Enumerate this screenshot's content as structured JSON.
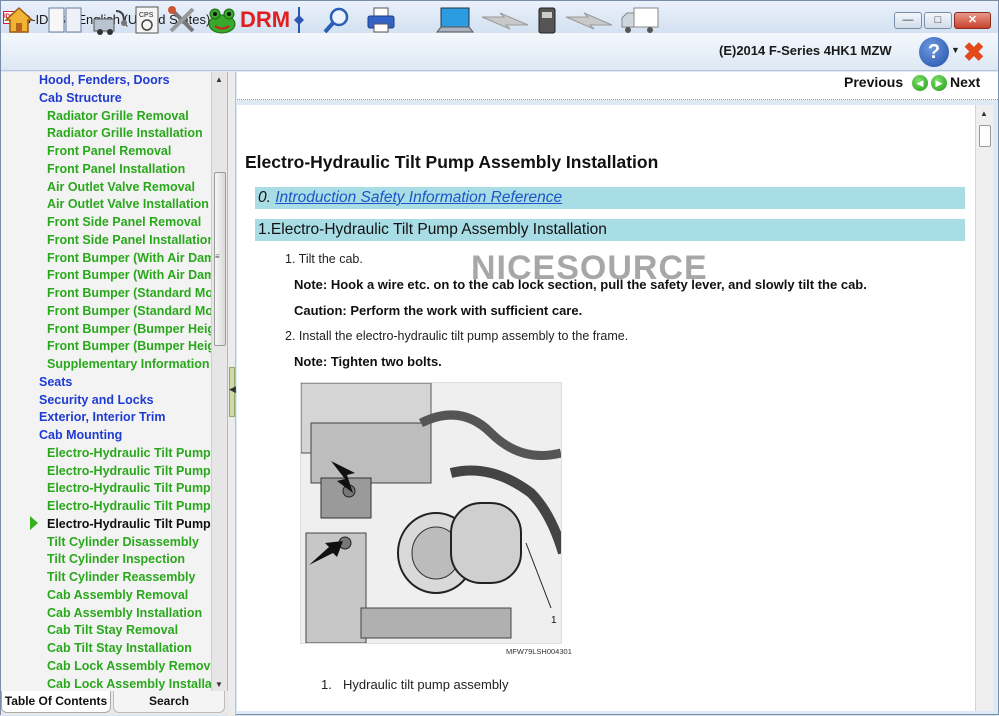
{
  "window": {
    "title": "G-IDSS - English (United States)",
    "app_icon_text": "IDSS",
    "min_glyph": "—",
    "max_glyph": "□",
    "close_glyph": "✕"
  },
  "toolbar": {
    "drm_label": "DRM",
    "vehicle": "(E)2014 F-Series 4HK1 MZW",
    "help_glyph": "?",
    "help_dropdown_glyph": "▼",
    "exit_glyph": "✖",
    "icons": [
      "home-icon",
      "book-icon",
      "diagnosis-icon",
      "cps-icon",
      "tools-icon",
      "frog-icon",
      "drm-icon",
      "pin-icon",
      "magnifier-icon",
      "printer-icon",
      "laptop-icon",
      "lightning-icon",
      "interface-device-icon",
      "lightning-icon",
      "truck-icon",
      "help-icon",
      "exit-icon"
    ]
  },
  "sidebar": {
    "items": [
      {
        "label": "Hood, Fenders, Doors",
        "level": 1
      },
      {
        "label": "Cab Structure",
        "level": 1
      },
      {
        "label": "Radiator Grille Removal",
        "level": 2
      },
      {
        "label": "Radiator Grille Installation",
        "level": 2
      },
      {
        "label": "Front Panel Removal",
        "level": 2
      },
      {
        "label": "Front Panel Installation",
        "level": 2
      },
      {
        "label": "Air Outlet Valve Removal",
        "level": 2
      },
      {
        "label": "Air Outlet Valve Installation",
        "level": 2
      },
      {
        "label": "Front Side Panel Removal",
        "level": 2
      },
      {
        "label": "Front Side Panel Installation",
        "level": 2
      },
      {
        "label": "Front Bumper (With Air Dam)",
        "level": 2
      },
      {
        "label": "Front Bumper (With Air Dam)",
        "level": 2
      },
      {
        "label": "Front Bumper (Standard Model)",
        "level": 2
      },
      {
        "label": "Front Bumper (Standard Model)",
        "level": 2
      },
      {
        "label": "Front Bumper (Bumper Height)",
        "level": 2
      },
      {
        "label": "Front Bumper (Bumper Height)",
        "level": 2
      },
      {
        "label": "Supplementary Information",
        "level": 2
      },
      {
        "label": "Seats",
        "level": 1
      },
      {
        "label": "Security and Locks",
        "level": 1
      },
      {
        "label": "Exterior, Interior Trim",
        "level": 1
      },
      {
        "label": "Cab Mounting",
        "level": 1
      },
      {
        "label": "Electro-Hydraulic Tilt Pump",
        "level": 2
      },
      {
        "label": "Electro-Hydraulic Tilt Pump",
        "level": 2
      },
      {
        "label": "Electro-Hydraulic Tilt Pump",
        "level": 2
      },
      {
        "label": "Electro-Hydraulic Tilt Pump",
        "level": 2
      },
      {
        "label": "Electro-Hydraulic Tilt Pump",
        "level": 2,
        "selected": true
      },
      {
        "label": "Tilt Cylinder Disassembly",
        "level": 2
      },
      {
        "label": "Tilt Cylinder Inspection",
        "level": 2
      },
      {
        "label": "Tilt Cylinder Reassembly",
        "level": 2
      },
      {
        "label": "Cab Assembly Removal",
        "level": 2
      },
      {
        "label": "Cab Assembly Installation",
        "level": 2
      },
      {
        "label": "Cab Tilt Stay Removal",
        "level": 2
      },
      {
        "label": "Cab Tilt Stay Installation",
        "level": 2
      },
      {
        "label": "Cab Lock Assembly Removal",
        "level": 2
      },
      {
        "label": "Cab Lock Assembly Installation",
        "level": 2
      }
    ],
    "scroll_up_glyph": "▲",
    "scroll_down_glyph": "▼",
    "grip_glyph": "≡",
    "tabs": {
      "toc": "Table Of Contents",
      "search": "Search"
    }
  },
  "splitter": {
    "arrow_glyph": "◀"
  },
  "nav": {
    "previous": "Previous",
    "next": "Next",
    "prev_glyph": "◀",
    "next_glyph": "▶"
  },
  "content": {
    "title": "Electro-Hydraulic Tilt Pump Assembly Installation",
    "intro_num": "0.",
    "intro_link": "Introduction Safety Information Reference",
    "section": "1.Electro-Hydraulic Tilt Pump Assembly Installation",
    "step1": "1. Tilt the cab.",
    "note1": "Note: Hook a wire etc. on to the cab lock section, pull the safety lever, and slowly tilt the cab.",
    "caution1": "Caution: Perform the work with sufficient care.",
    "step2": "2. Install the electro-hydraulic tilt pump assembly to the frame.",
    "note2": "Note: Tighten two bolts.",
    "watermark": "NICESOURCE",
    "figure_code": "MFW79LSH004301",
    "figure_callout": "1",
    "legend_num": "1.",
    "legend_text": "Hydraulic tilt pump assembly",
    "scroll_up_glyph": "▲"
  },
  "colors": {
    "level1": "#1f3bd1",
    "level2": "#2aa81c",
    "band": "#a9dde5",
    "link": "#1b55c7"
  }
}
